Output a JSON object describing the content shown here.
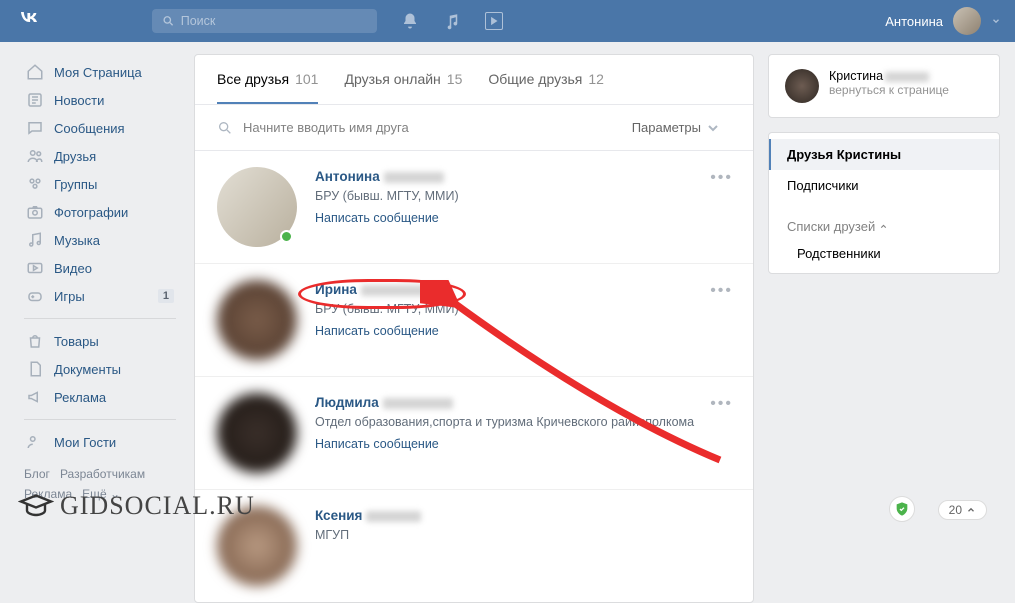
{
  "topbar": {
    "search_placeholder": "Поиск",
    "username": "Антонина"
  },
  "sidenav": {
    "items": [
      {
        "label": "Моя Страница",
        "icon": "home"
      },
      {
        "label": "Новости",
        "icon": "news"
      },
      {
        "label": "Сообщения",
        "icon": "msg"
      },
      {
        "label": "Друзья",
        "icon": "users"
      },
      {
        "label": "Группы",
        "icon": "group"
      },
      {
        "label": "Фотографии",
        "icon": "photo"
      },
      {
        "label": "Музыка",
        "icon": "music"
      },
      {
        "label": "Видео",
        "icon": "video"
      },
      {
        "label": "Игры",
        "icon": "game",
        "badge": "1"
      }
    ],
    "secondary": [
      {
        "label": "Товары",
        "icon": "shop"
      },
      {
        "label": "Документы",
        "icon": "doc"
      },
      {
        "label": "Реклама",
        "icon": "ad"
      }
    ],
    "footer": {
      "guests": "Мои Гости",
      "blog": "Блог",
      "devs": "Разработчикам",
      "ads": "Реклама",
      "more": "Ещё"
    }
  },
  "tabs": {
    "all": {
      "label": "Все друзья",
      "count": "101"
    },
    "online": {
      "label": "Друзья онлайн",
      "count": "15"
    },
    "mutual": {
      "label": "Общие друзья",
      "count": "12"
    }
  },
  "filter": {
    "placeholder": "Начните вводить имя друга",
    "params": "Параметры"
  },
  "friends": [
    {
      "name": "Антонина",
      "sub": "БРУ (бывш. МГТУ, ММИ)",
      "link": "Написать сообщение",
      "online": true
    },
    {
      "name": "Ирина",
      "sub": "БРУ (бывш. МГТУ, ММИ)",
      "link": "Написать сообщение",
      "online": false
    },
    {
      "name": "Людмила",
      "sub": "Отдел образования,спорта и туризма Кричевского райисполкома",
      "link": "Написать сообщение",
      "online": false
    },
    {
      "name": "Ксения",
      "sub": "МГУП",
      "link": "",
      "online": false
    }
  ],
  "aside": {
    "profile": {
      "name": "Кристина",
      "back": "вернуться к странице"
    },
    "friends_of": "Друзья Кристины",
    "subscribers": "Подписчики",
    "lists_title": "Списки друзей",
    "relatives": "Родственники"
  },
  "counter": "20",
  "watermark": "GIDSOCIAL.RU"
}
